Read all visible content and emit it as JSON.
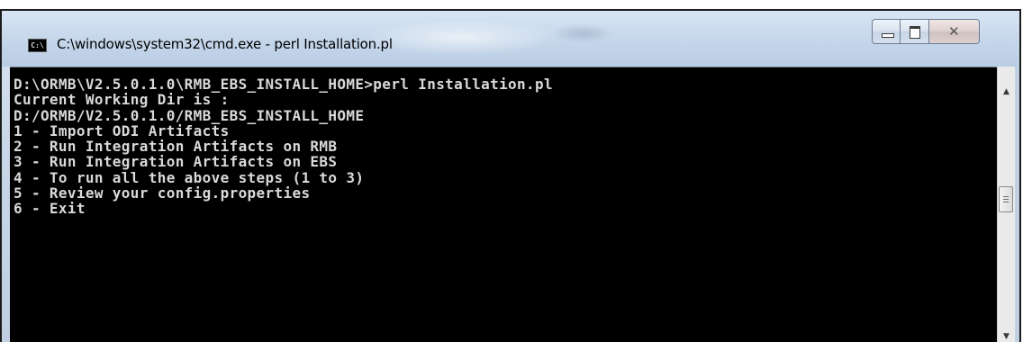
{
  "window": {
    "title": "C:\\windows\\system32\\cmd.exe - perl  Installation.pl",
    "icon_label": "C:\\",
    "controls": {
      "minimize_icon": "minimize-icon",
      "maximize_icon": "maximize-icon",
      "close_glyph": "✕"
    }
  },
  "console": {
    "lines": [
      "D:\\ORMB\\V2.5.0.1.0\\RMB_EBS_INSTALL_HOME>perl Installation.pl",
      "Current Working Dir is :",
      "D:/ORMB/V2.5.0.1.0/RMB_EBS_INSTALL_HOME",
      "1 - Import ODI Artifacts",
      "2 - Run Integration Artifacts on RMB",
      "3 - Run Integration Artifacts on EBS",
      "4 - To run all the above steps (1 to 3)",
      "5 - Review your config.properties",
      "6 - Exit"
    ],
    "background_color": "#000000",
    "text_color": "#d9d9d9"
  },
  "scrollbar": {
    "up_arrow": "▲",
    "down_arrow": "▼"
  }
}
